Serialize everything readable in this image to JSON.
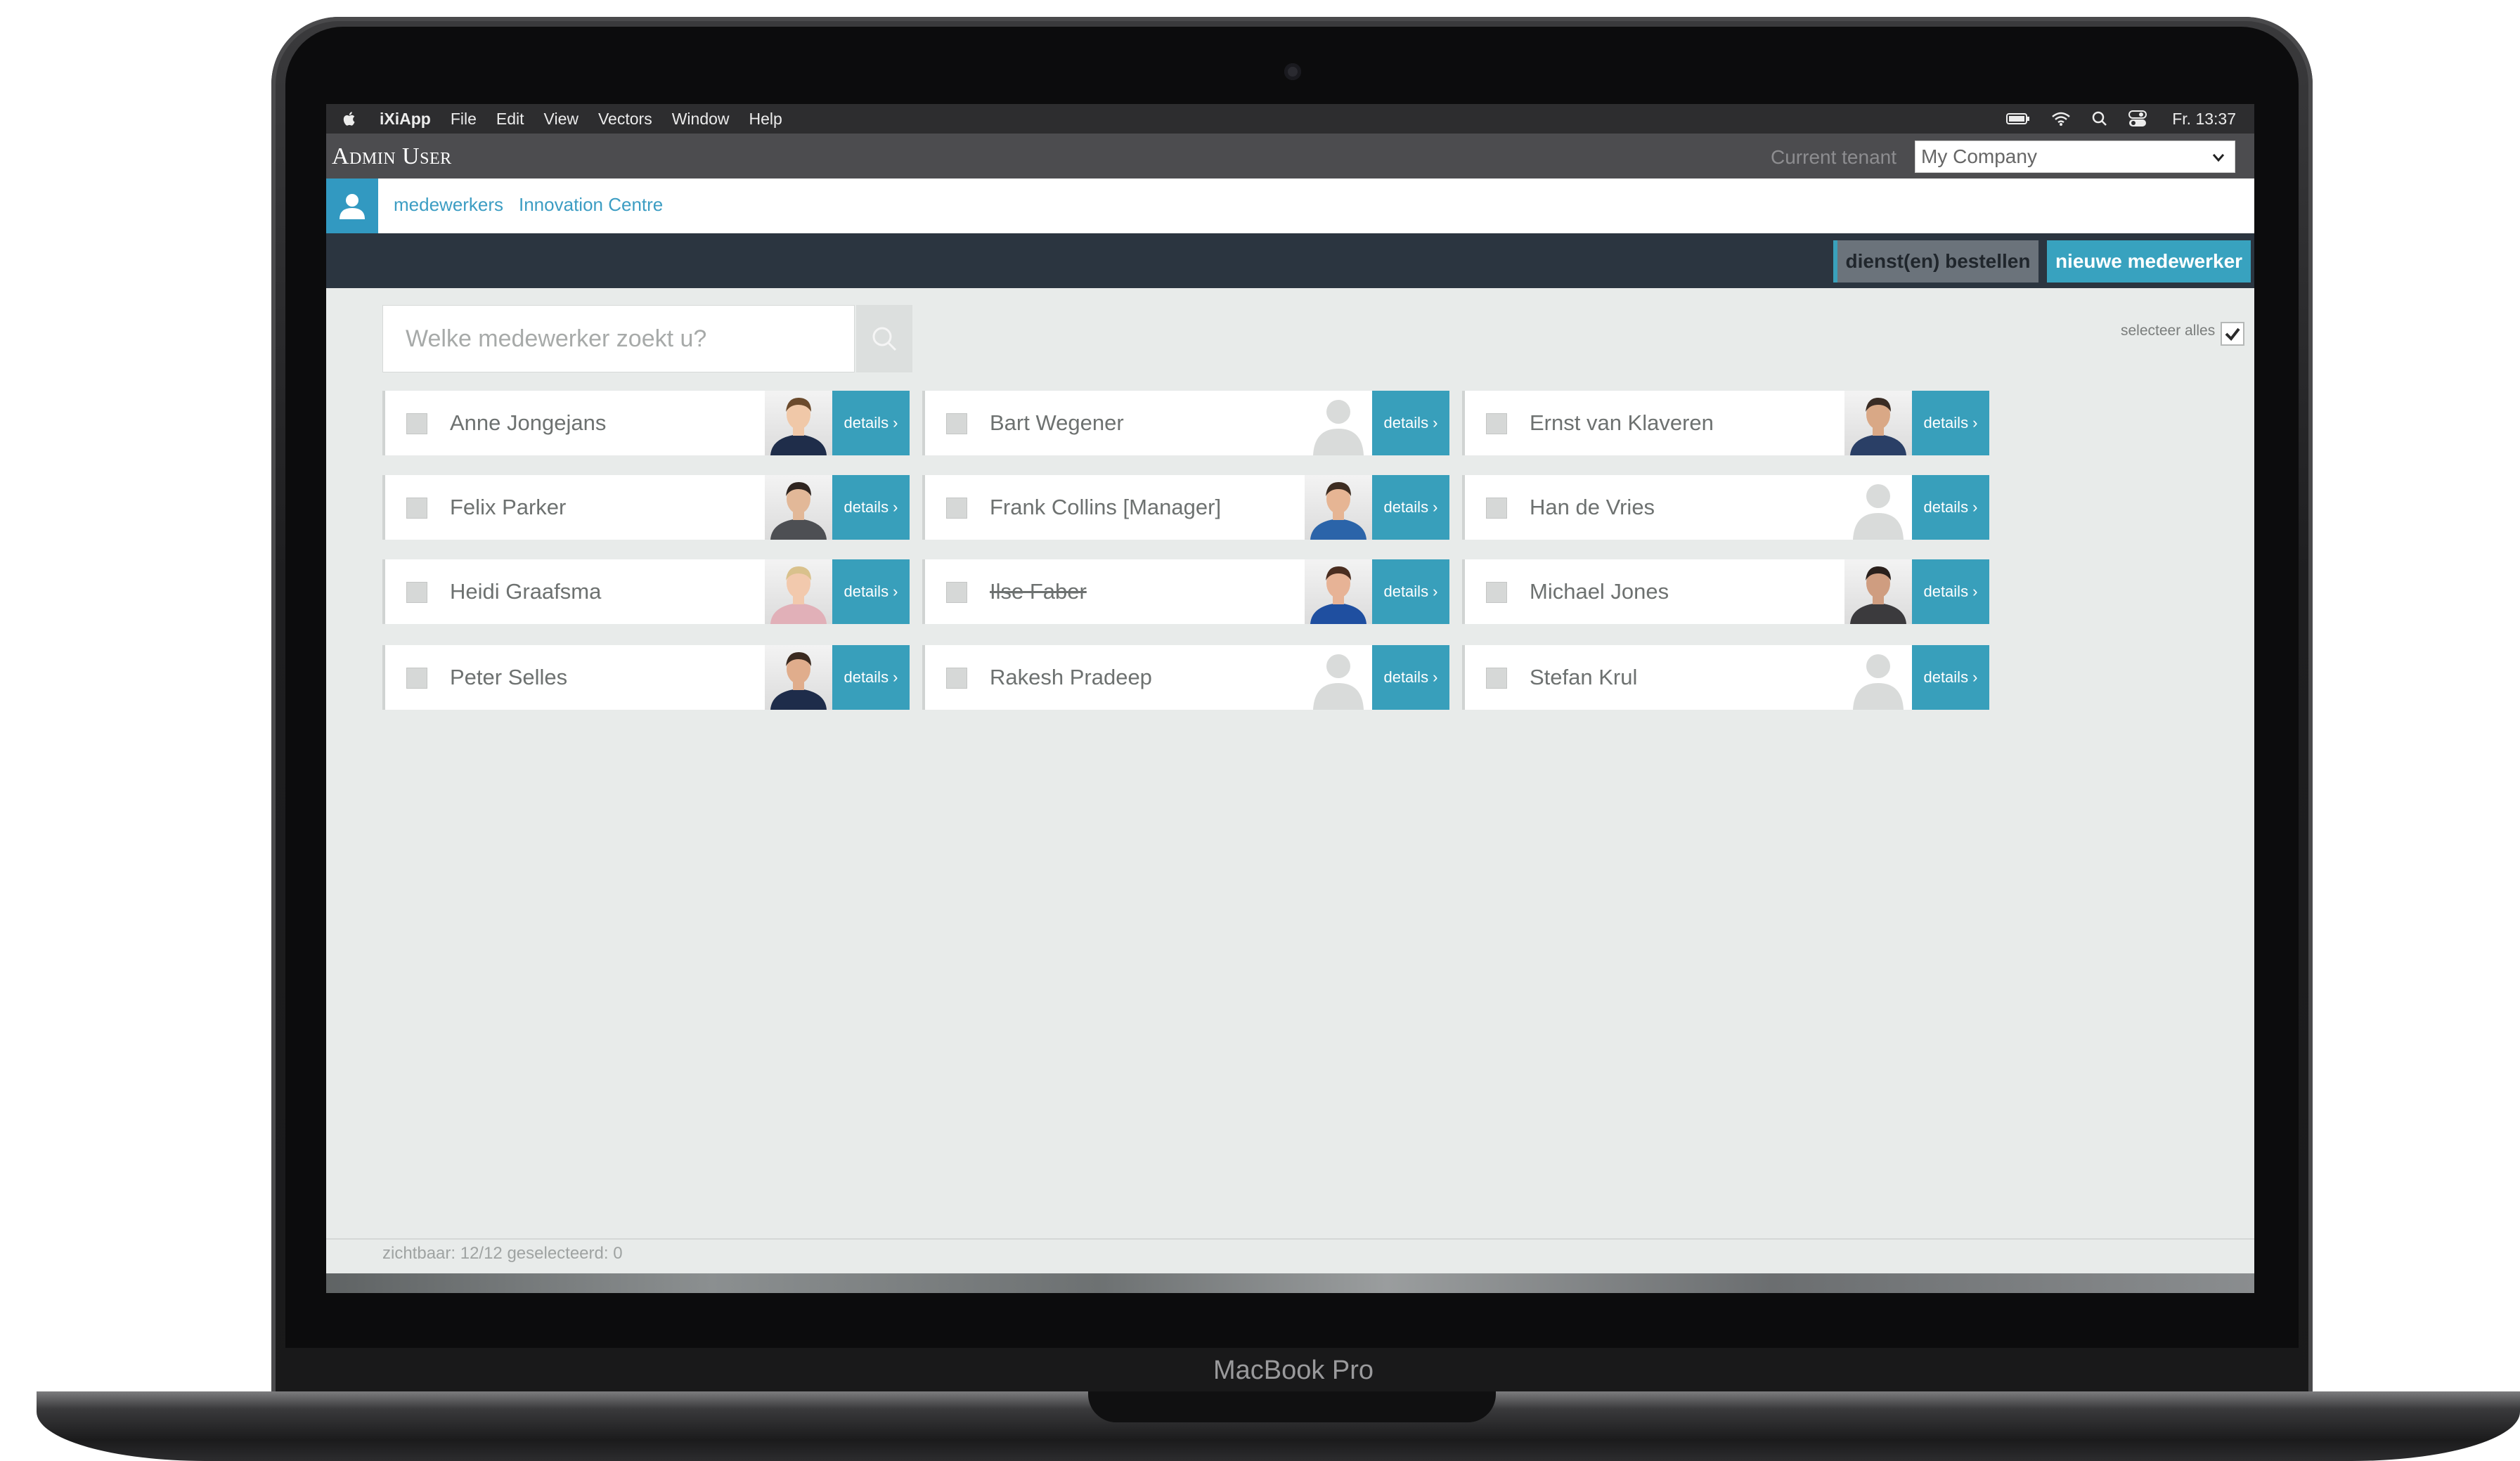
{
  "menubar": {
    "app_name": "iXiApp",
    "items": [
      "File",
      "Edit",
      "View",
      "Vectors",
      "Window",
      "Help"
    ],
    "clock": "Fr. 13:37"
  },
  "header": {
    "title": "Admin User",
    "tenant_label": "Current tenant",
    "tenant_value": "My Company"
  },
  "breadcrumb": [
    "medewerkers",
    "Innovation Centre"
  ],
  "actions": {
    "order_label": "dienst(en) bestellen",
    "new_label": "nieuwe medewerker"
  },
  "search": {
    "placeholder": "Welke medewerker zoekt u?"
  },
  "select_all_label": "selecteer alles",
  "details_label": "details",
  "employees": [
    {
      "name": "Anne Jongejans",
      "photo": true,
      "struck": false
    },
    {
      "name": "Bart Wegener",
      "photo": false,
      "struck": false
    },
    {
      "name": "Ernst van Klaveren",
      "photo": true,
      "struck": false
    },
    {
      "name": "Felix Parker",
      "photo": true,
      "struck": false
    },
    {
      "name": "Frank Collins [Manager]",
      "photo": true,
      "struck": false
    },
    {
      "name": "Han de Vries",
      "photo": false,
      "struck": false
    },
    {
      "name": "Heidi Graafsma",
      "photo": true,
      "struck": false
    },
    {
      "name": "Ilse Faber",
      "photo": true,
      "struck": true
    },
    {
      "name": "Michael Jones",
      "photo": true,
      "struck": false
    },
    {
      "name": "Peter Selles",
      "photo": true,
      "struck": false
    },
    {
      "name": "Rakesh Pradeep",
      "photo": false,
      "struck": false
    },
    {
      "name": "Stefan Krul",
      "photo": false,
      "struck": false
    }
  ],
  "footer": {
    "status": "zichtbaar: 12/12 geselecteerd: 0"
  },
  "device_label": "MacBook Pro",
  "colors": {
    "accent": "#389fbb",
    "action_bar": "#2b3540",
    "admin_bar": "#4c4c4f"
  }
}
